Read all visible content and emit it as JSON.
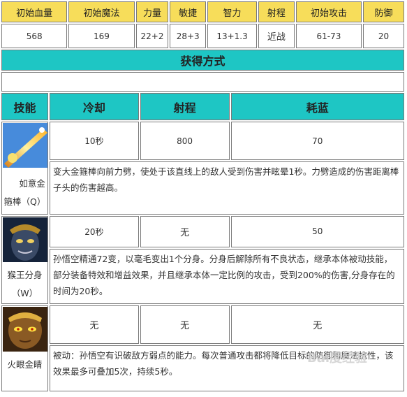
{
  "stats": {
    "headers": [
      "初始血量",
      "初始魔法",
      "力量",
      "敏捷",
      "智力",
      "射程",
      "初始攻击",
      "防御"
    ],
    "values": [
      "568",
      "169",
      "22+2",
      "28+3",
      "13+1.3",
      "近战",
      "61-73",
      "20"
    ]
  },
  "acquire": {
    "title": "获得方式",
    "content": ""
  },
  "skills": {
    "headers": {
      "skill": "技能",
      "cooldown": "冷却",
      "range": "射程",
      "mana": "耗蓝"
    },
    "colors": {
      "teal": "#1ec6c4",
      "yellow": "#f7dd5a"
    },
    "rows": [
      {
        "name_line1": "如意金",
        "name_line2": "箍棒（Q）",
        "icon": "golden-staff-icon",
        "cooldown": "10秒",
        "range": "800",
        "mana": "70",
        "description": "变大金箍棒向前力劈，使处于该直线上的敌人受到伤害并眩晕1秒。力劈造成的伤害距离棒子头的伤害越高。"
      },
      {
        "name_line1": "猴王分身",
        "name_line2": "（W）",
        "icon": "monkey-king-clone-icon",
        "cooldown": "20秒",
        "range": "无",
        "mana": "50",
        "description": "孙悟空精通72变，以毫毛变出1个分身。分身后解除所有不良状态，继承本体被动技能，部分装备特效和增益效果，并且继承本体一定比例的攻击，受到200%的伤害,分身存在的时间为20秒。"
      },
      {
        "name_line1": "火眼金睛",
        "name_line2": "",
        "icon": "fiery-eyes-icon",
        "cooldown": "无",
        "range": "无",
        "mana": "无",
        "description": "被动：孙悟空有识破敌方弱点的能力。每次普通攻击都将降低目标的防御和魔法抗性，该效果最多可叠加5次，持续5秒。"
      }
    ]
  },
  "watermark": "Bai度经验"
}
